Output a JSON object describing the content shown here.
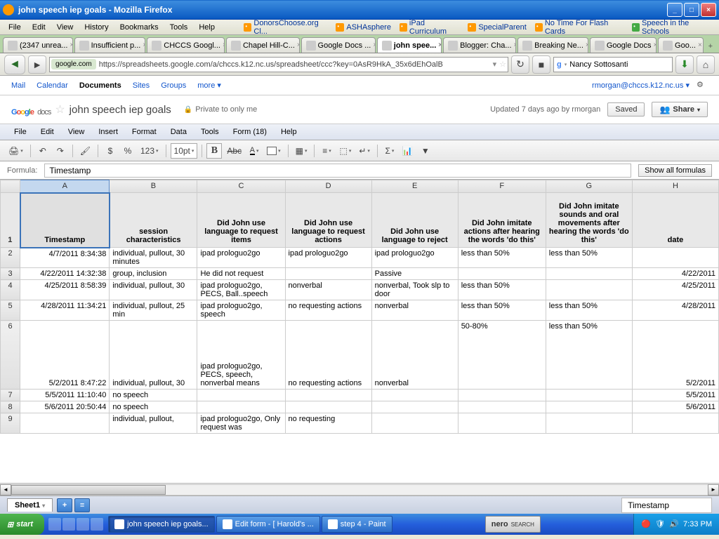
{
  "window": {
    "title": "john speech iep goals - Mozilla Firefox"
  },
  "ff_menu": [
    "File",
    "Edit",
    "View",
    "History",
    "Bookmarks",
    "Tools",
    "Help"
  ],
  "ff_bookmarks": [
    "DonorsChoose.org Cl...",
    "ASHAsphere",
    "iPad Curriculum",
    "SpecialParent",
    "No Time For Flash Cards",
    "Speech in the Schools"
  ],
  "ff_tabs": [
    {
      "label": "(2347 unrea..."
    },
    {
      "label": "Insufficient p..."
    },
    {
      "label": "CHCCS Googl..."
    },
    {
      "label": "Chapel Hill-C..."
    },
    {
      "label": "Google Docs ..."
    },
    {
      "label": "john spee...",
      "active": true
    },
    {
      "label": "Blogger: Cha..."
    },
    {
      "label": "Breaking Ne..."
    },
    {
      "label": "Google Docs"
    },
    {
      "label": "Goo..."
    }
  ],
  "url": {
    "chip": "google.com",
    "path": "https://spreadsheets.google.com/a/chccs.k12.nc.us/spreadsheet/ccc?key=0AsR9HkA_35x6dEhOalB"
  },
  "searchbox": {
    "value": "Nancy Sottosanti"
  },
  "gd_nav": {
    "mail": "Mail",
    "calendar": "Calendar",
    "documents": "Documents",
    "sites": "Sites",
    "groups": "Groups",
    "more": "more ▾",
    "user": "rmorgan@chccs.k12.nc.us ▾"
  },
  "doc": {
    "name": "john speech iep goals",
    "privacy": "Private to only me",
    "updated": "Updated 7 days ago by rmorgan",
    "saved": "Saved",
    "share": "Share"
  },
  "gd_menu": {
    "file": "File",
    "edit": "Edit",
    "view": "View",
    "insert": "Insert",
    "format": "Format",
    "data": "Data",
    "tools": "Tools",
    "form": "Form (18)",
    "help": "Help"
  },
  "toolbar": {
    "fontsize": "10pt",
    "numfmt": "123",
    "pct": "%",
    "cur": "$"
  },
  "formula": {
    "label": "Formula:",
    "value": "Timestamp",
    "showall": "Show all formulas"
  },
  "cols": [
    "A",
    "B",
    "C",
    "D",
    "E",
    "F",
    "G",
    "H"
  ],
  "headers": {
    "A": "Timestamp",
    "B": "session characteristics",
    "C": "Did John use language to request items",
    "D": "Did John use language to request actions",
    "E": "Did John use language to reject",
    "F": "Did John imitate actions after hearing the words 'do this'",
    "G": "Did John imitate sounds and oral movements after hearing the words 'do this'",
    "H": "date"
  },
  "rows": [
    {
      "n": "2",
      "A": "4/7/2011 8:34:38",
      "B": "individual, pullout, 30 minutes",
      "C": "ipad prologuo2go",
      "D": "ipad prologuo2go",
      "E": "ipad prologuo2go",
      "F": "less than 50%",
      "G": "less than 50%",
      "H": ""
    },
    {
      "n": "3",
      "A": "4/22/2011 14:32:38",
      "B": "group, inclusion",
      "C": "He did not request",
      "D": "",
      "E": "Passive",
      "F": "",
      "G": "",
      "H": "4/22/2011"
    },
    {
      "n": "4",
      "A": "4/25/2011 8:58:39",
      "B": "individual, pullout, 30",
      "C": "ipad prologuo2go, PECS, Ball..speech",
      "D": "nonverbal",
      "E": "nonverbal, Took slp to door",
      "F": "less than 50%",
      "G": "",
      "H": "4/25/2011"
    },
    {
      "n": "5",
      "A": "4/28/2011 11:34:21",
      "B": "individual, pullout, 25 min",
      "C": "ipad prologuo2go, speech",
      "D": "no requesting actions",
      "E": "nonverbal",
      "F": "less than 50%",
      "G": "less than 50%",
      "H": "4/28/2011"
    },
    {
      "n": "6",
      "A": "5/2/2011 8:47:22",
      "B": "individual, pullout, 30",
      "C": "ipad prologuo2go, PECS, speech, nonverbal means",
      "D": "no requesting actions",
      "E": "nonverbal",
      "F": "50-80%",
      "G": "less than 50%",
      "H": "5/2/2011",
      "tall": true
    },
    {
      "n": "7",
      "A": "5/5/2011 11:10:40",
      "B": "no speech",
      "C": "",
      "D": "",
      "E": "",
      "F": "",
      "G": "",
      "H": "5/5/2011"
    },
    {
      "n": "8",
      "A": "5/6/2011 20:50:44",
      "B": "no speech",
      "C": "",
      "D": "",
      "E": "",
      "F": "",
      "G": "",
      "H": "5/6/2011"
    },
    {
      "n": "9",
      "A": "",
      "B": "individual, pullout,",
      "C": "ipad prologuo2go, Only request was",
      "D": "no requesting",
      "E": "",
      "F": "",
      "G": "",
      "H": ""
    }
  ],
  "sheettab": {
    "name": "Sheet1",
    "status": "Timestamp"
  },
  "taskbar": {
    "start": "start",
    "tasks": [
      {
        "label": "john speech iep goals...",
        "active": true
      },
      {
        "label": "Edit form - [ Harold's ..."
      },
      {
        "label": "step 4 - Paint"
      }
    ],
    "nero": "nero",
    "search": "SEARCH",
    "time": "7:33 PM"
  }
}
